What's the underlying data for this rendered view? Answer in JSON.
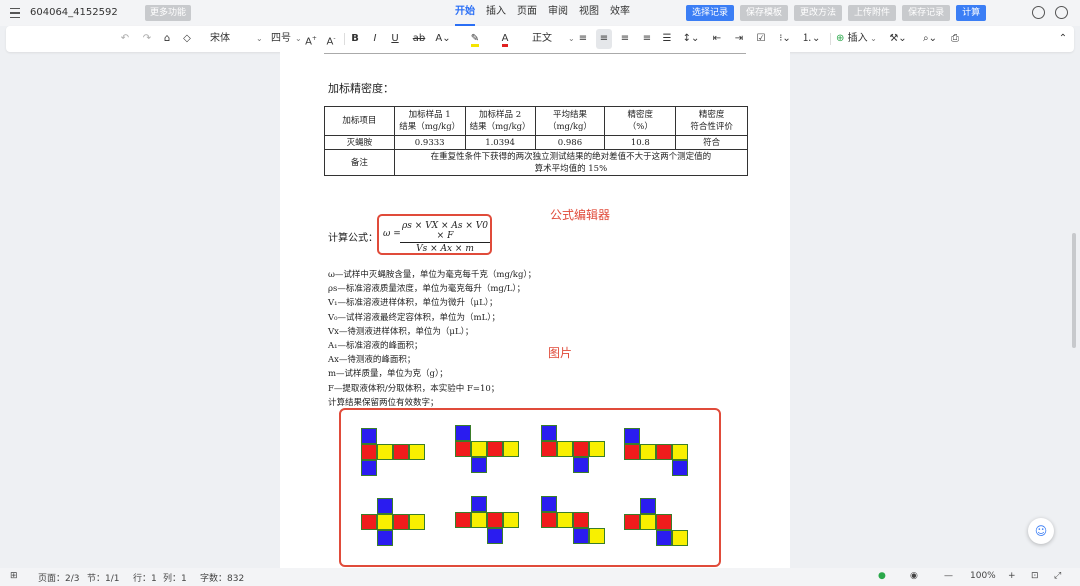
{
  "titlebar": {
    "doc_name": "604064_4152592",
    "more_label": "更多功能",
    "tabs": [
      "开始",
      "插入",
      "页面",
      "审阅",
      "视图",
      "效率"
    ],
    "active_tab": "开始",
    "actions": [
      "选择记录",
      "保存模板",
      "更改方法",
      "上传附件",
      "保存记录",
      "计算"
    ],
    "accent": "#2a6ff6"
  },
  "toolbar": {
    "font_name": "宋体",
    "font_size": "四号",
    "style_name": "正文",
    "bold": "B",
    "italic": "I",
    "underline": "U",
    "strike": "ab",
    "insert_label": "插入"
  },
  "document": {
    "heading": "加标精密度：",
    "table": {
      "headers": [
        "加标项目",
        "加标样品 1\n结果（mg/kg）",
        "加标样品 2\n结果（mg/kg）",
        "平均结果\n（mg/kg）",
        "精密度\n（%）",
        "精密度\n符合性评价"
      ],
      "row": [
        "灭蝇胺",
        "0.9333",
        "1.0394",
        "0.986",
        "10.8",
        "符合"
      ],
      "note_label": "备注",
      "note_text_1": "在重复性条件下获得的两次独立测试结果的绝对差值不大于这两个测定值的",
      "note_text_2": "算术平均值的 15%"
    },
    "formula_label": "计算公式：",
    "formula_lhs": "ω =",
    "formula_num": "ρs × VX × As × V0 × F",
    "formula_den": "Vs × Ax × m",
    "formula_annotation": "公式编辑器",
    "definitions": [
      "ω—试样中灭蝇胺含量，单位为毫克每千克（mg/kg）；",
      "ρs—标准溶液质量浓度，单位为毫克每升（mg/L）；",
      "V₁—标准溶液进样体积，单位为微升（μL）；",
      "V₀—试样溶液最终定容体积，单位为（mL）；",
      "Vx—待测液进样体积，单位为（μL）；",
      "A₁—标准溶液的峰面积；",
      "Ax—待测液的峰面积；",
      "m—试样质量，单位为克（g）；",
      "F—提取液体积/分取体积，本实验中 F=10；",
      "计算结果保留两位有效数字；"
    ],
    "image_annotation": "图片"
  },
  "statusbar": {
    "page": "页面：2/3",
    "section": "节：1/1",
    "line": "行：1",
    "column": "列：1",
    "words": "字数：832",
    "zoom": "100%"
  }
}
